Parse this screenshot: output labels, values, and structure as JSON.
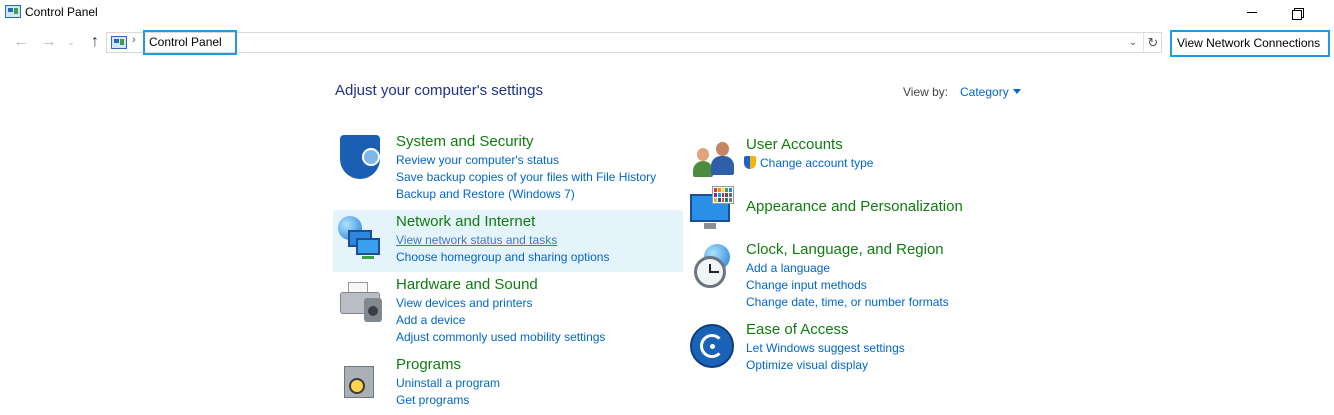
{
  "window": {
    "title": "Control Panel",
    "minimize_glyph": "—",
    "maximize_glyph": "❐"
  },
  "nav": {
    "back_glyph": "←",
    "forward_glyph": "→",
    "recent_glyph": "⌄",
    "up_glyph": "↑"
  },
  "address": {
    "separator": "›",
    "crumb": "Control Panel",
    "dropdown_glyph": "⌄",
    "refresh_glyph": "↻"
  },
  "toolbar": {
    "view_network_connections": "View Network Connections"
  },
  "content": {
    "heading": "Adjust your computer's settings",
    "view_by_label": "View by:",
    "view_by_value": "Category"
  },
  "categories": {
    "system_security": {
      "title": "System and Security",
      "links": [
        "Review your computer's status",
        "Save backup copies of your files with File History",
        "Backup and Restore (Windows 7)"
      ]
    },
    "network_internet": {
      "title": "Network and Internet",
      "links": [
        "View network status and tasks",
        "Choose homegroup and sharing options"
      ]
    },
    "hardware_sound": {
      "title": "Hardware and Sound",
      "links": [
        "View devices and printers",
        "Add a device",
        "Adjust commonly used mobility settings"
      ]
    },
    "programs": {
      "title": "Programs",
      "links": [
        "Uninstall a program",
        "Get programs"
      ]
    },
    "user_accounts": {
      "title": "User Accounts",
      "links": [
        "Change account type"
      ]
    },
    "appearance": {
      "title": "Appearance and Personalization"
    },
    "clock_region": {
      "title": "Clock, Language, and Region",
      "links": [
        "Add a language",
        "Change input methods",
        "Change date, time, or number formats"
      ]
    },
    "ease_access": {
      "title": "Ease of Access",
      "links": [
        "Let Windows suggest settings",
        "Optimize visual display"
      ]
    }
  },
  "colors": {
    "category_title": "#107c10",
    "link": "#0066cc",
    "heading": "#1e3287",
    "highlight": "#e5f3fb",
    "focus_border": "#1e9be3"
  }
}
